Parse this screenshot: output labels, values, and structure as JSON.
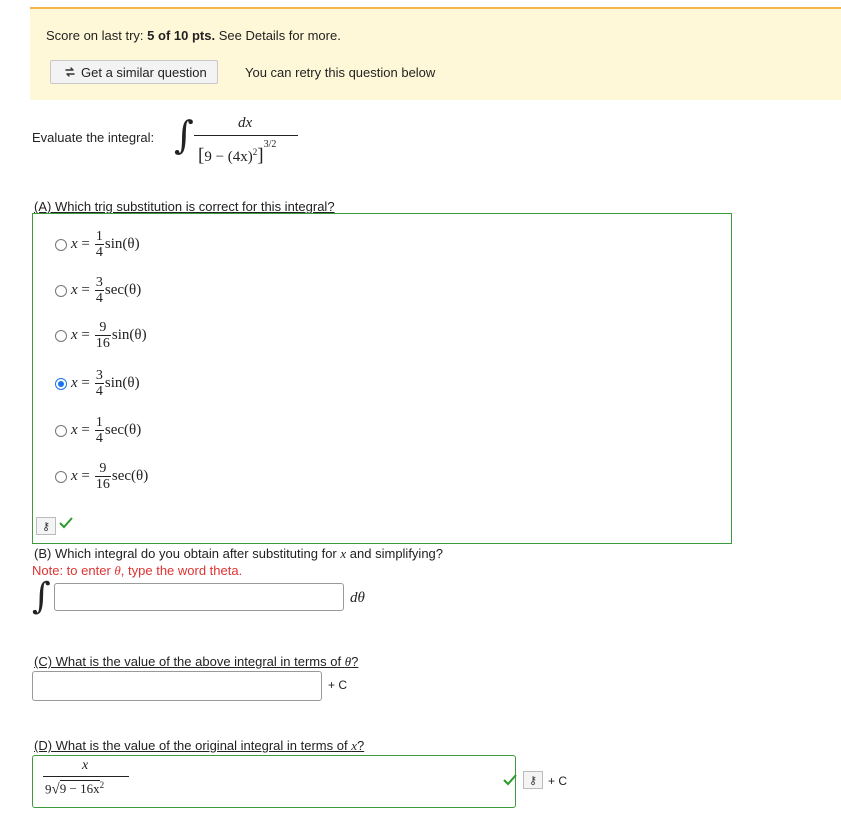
{
  "score": {
    "prefix": "Score on last try:",
    "value": "5 of 10 pts.",
    "suffix": "See Details for more."
  },
  "similar_button": {
    "label": "Get a similar question",
    "icon": "refresh-icon"
  },
  "retry_note": "You can retry this question below",
  "prompt": {
    "label": "Evaluate the integral:",
    "numerator": "dx",
    "denominator_base": "9 − (4x)",
    "inner_exponent": "2",
    "outer_exponent": "3/2"
  },
  "partA": {
    "question": "(A) Which trig substitution is correct for this integral?",
    "options": [
      {
        "num": "1",
        "den": "4",
        "fn": "sin(θ)",
        "selected": false
      },
      {
        "num": "3",
        "den": "4",
        "fn": "sec(θ)",
        "selected": false
      },
      {
        "num": "9",
        "den": "16",
        "fn": "sin(θ)",
        "selected": false
      },
      {
        "num": "3",
        "den": "4",
        "fn": "sin(θ)",
        "selected": true
      },
      {
        "num": "1",
        "den": "4",
        "fn": "sec(θ)",
        "selected": false
      },
      {
        "num": "9",
        "den": "16",
        "fn": "sec(θ)",
        "selected": false
      }
    ],
    "status": "correct"
  },
  "partB": {
    "question_prefix": "(B) Which integral do you obtain after substituting for",
    "question_var": "x",
    "question_suffix": "and simplifying?",
    "note_prefix": "Note: to enter",
    "note_var": "θ",
    "note_suffix": ", type the word theta.",
    "input_value": "",
    "suffix": "dθ"
  },
  "partC": {
    "question_prefix": "(C) What is the value of the above integral in terms of",
    "question_var": "θ",
    "question_suffix": "?",
    "input_value": "",
    "plus_c": "+ C"
  },
  "partD": {
    "question_prefix": "(D) What is the value of the original integral in terms of",
    "question_var": "x",
    "question_suffix": "?",
    "answer_num": "x",
    "answer_coef": "9",
    "answer_radicand": "9 − 16x",
    "answer_radicand_exp": "2",
    "plus_c": "+ C",
    "status": "correct"
  },
  "colors": {
    "banner_bg": "#fff8d8",
    "banner_border": "#f4b54a",
    "correct_green": "#3c9a3c",
    "note_red": "#dd3333",
    "radio_blue": "#1a73e8"
  }
}
